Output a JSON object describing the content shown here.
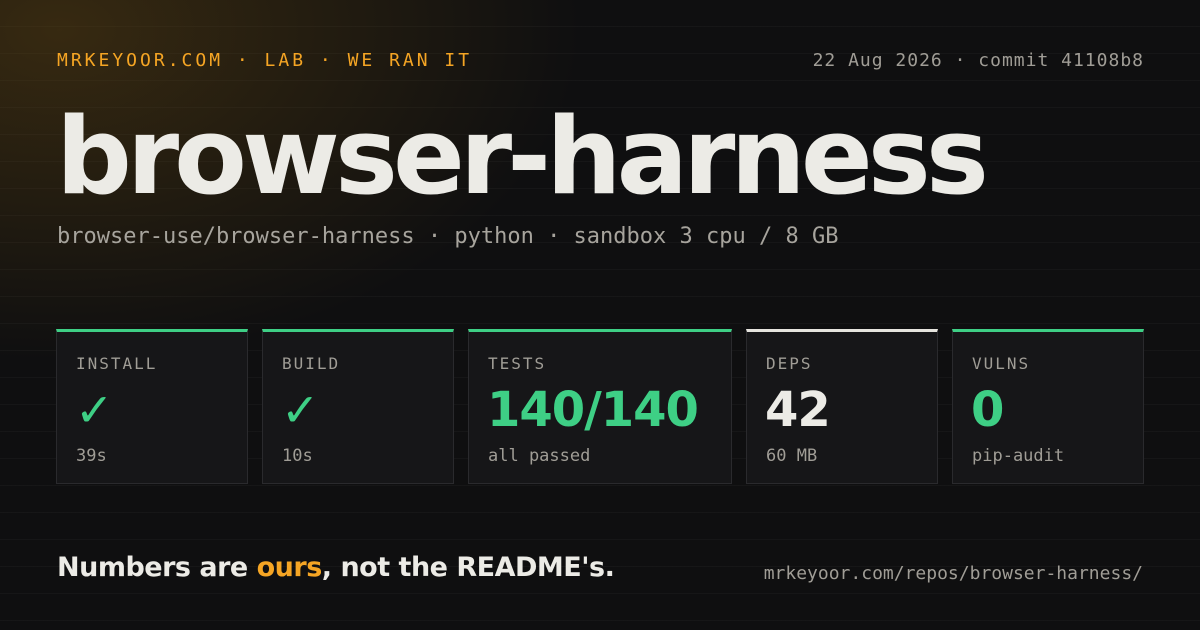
{
  "header": {
    "brand": "MRKEYOOR.COM · LAB · WE RAN IT",
    "meta": "22 Aug 2026 · commit 41108b8"
  },
  "title": "browser-harness",
  "subtitle": "browser-use/browser-harness · python · sandbox 3 cpu / 8 GB",
  "cards": [
    {
      "label": "INSTALL",
      "value": "✓",
      "sub": "39s",
      "status": "pass",
      "icon": "check-icon",
      "accent": "#3ecf85"
    },
    {
      "label": "BUILD",
      "value": "✓",
      "sub": "10s",
      "status": "pass",
      "icon": "check-icon",
      "accent": "#3ecf85"
    },
    {
      "label": "TESTS",
      "value": "140/140",
      "sub": "all passed",
      "status": "pass",
      "accent": "#3ecf85"
    },
    {
      "label": "DEPS",
      "value": "42",
      "sub": "60 MB",
      "status": "neutral",
      "accent": "#e6e4de"
    },
    {
      "label": "VULNS",
      "value": "0",
      "sub": "pip-audit",
      "status": "pass",
      "accent": "#3ecf85"
    }
  ],
  "footer": {
    "tagline_before": "Numbers are ",
    "tagline_accent": "ours",
    "tagline_after": ", not the README's.",
    "url": "mrkeyoor.com/repos/browser-harness/"
  },
  "colors": {
    "background": "#0f0f10",
    "brand_accent": "#f5a524",
    "success": "#3ecf85",
    "text_primary": "#ecebe6",
    "text_muted": "#a09d96",
    "card_background": "#161618"
  }
}
